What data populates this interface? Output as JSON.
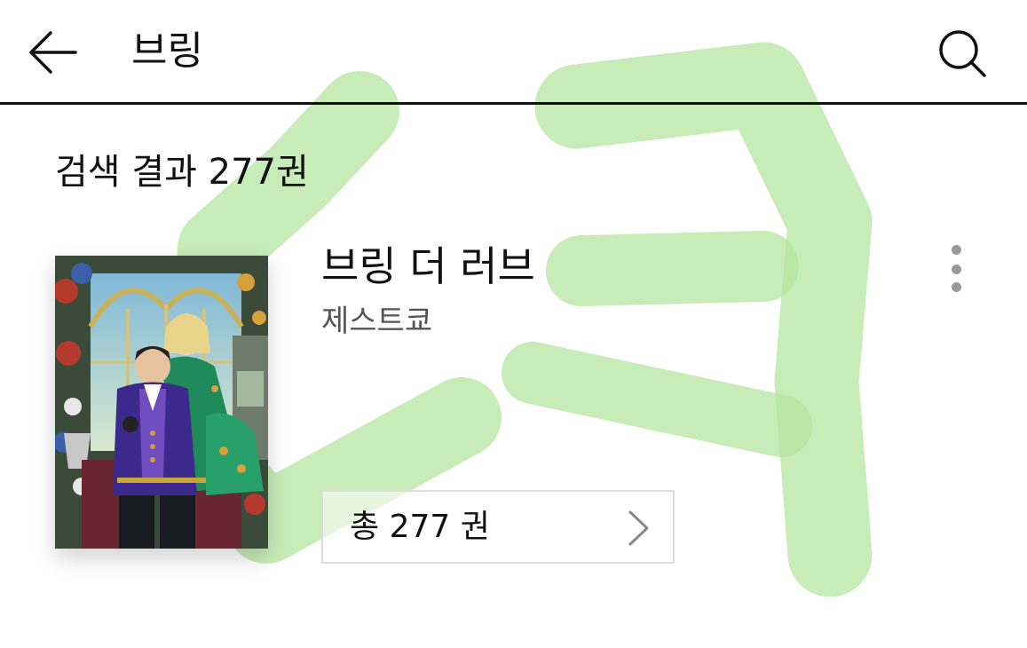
{
  "header": {
    "back_icon": "arrow-left-icon",
    "query": "브링",
    "search_icon": "search-icon"
  },
  "results": {
    "count_label": "검색 결과 277권"
  },
  "items": [
    {
      "title": "브링 더 러브",
      "author": "제스트쿄",
      "volumes_label": "총 277 권",
      "more_icon": "more-vertical-icon",
      "chevron_icon": "chevron-right-icon"
    }
  ],
  "colors": {
    "watermark": "#b5e6a0",
    "divider": "#111111",
    "muted_text": "#555555",
    "border": "#dddddd"
  }
}
